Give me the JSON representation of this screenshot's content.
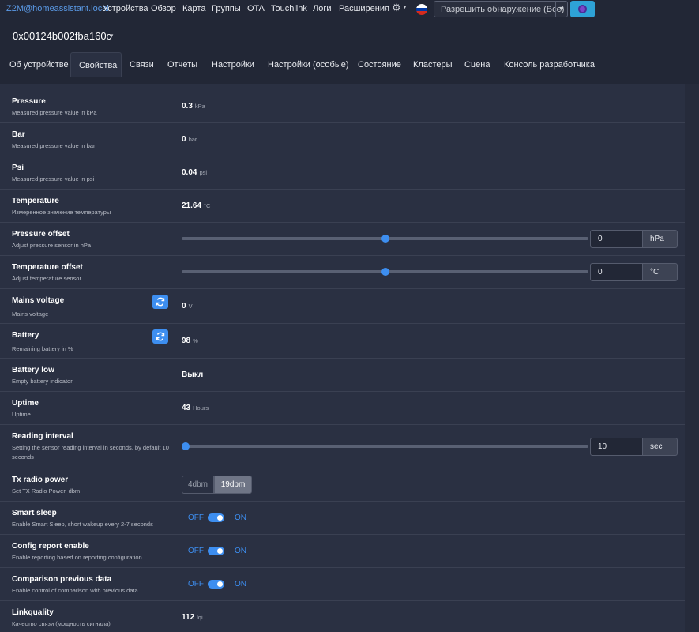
{
  "navbar": {
    "brand": "Z2M@homeassistant.local",
    "links": [
      "Устройства",
      "Обзор",
      "Карта",
      "Группы",
      "OTA",
      "Touchlink",
      "Логи",
      "Расширения"
    ],
    "permit_label": "Разрешить обнаружение (Все)",
    "flag_colors": [
      "#ffffff",
      "#0039a6",
      "#d52b1e"
    ]
  },
  "device": {
    "title": "0x00124b002fba160c"
  },
  "tabs": [
    "Об устройстве",
    "Свойства",
    "Связи",
    "Отчеты",
    "Настройки",
    "Настройки (особые)",
    "Состояние",
    "Кластеры",
    "Сцена",
    "Консоль разработчика"
  ],
  "active_tab": "Свойства",
  "props": {
    "pressure": {
      "title": "Pressure",
      "desc": "Measured pressure value in kPa",
      "value": "0.3",
      "unit": "kPa"
    },
    "bar": {
      "title": "Bar",
      "desc": "Measured pressure value in bar",
      "value": "0",
      "unit": "bar"
    },
    "psi": {
      "title": "Psi",
      "desc": "Measured pressure value in psi",
      "value": "0.04",
      "unit": "psi"
    },
    "temperature": {
      "title": "Temperature",
      "desc": "Измеренное значение температуры",
      "value": "21.64",
      "unit": "°C"
    },
    "pressure_offset": {
      "title": "Pressure offset",
      "desc": "Adjust pressure sensor in hPa",
      "value": "0",
      "unit": "hPa",
      "slider_fraction": 0.5
    },
    "temperature_offset": {
      "title": "Temperature offset",
      "desc": "Adjust temperature sensor",
      "value": "0",
      "unit": "°C",
      "slider_fraction": 0.5
    },
    "mains_voltage": {
      "title": "Mains voltage",
      "desc": "Mains voltage",
      "value": "0",
      "unit": "V"
    },
    "battery": {
      "title": "Battery",
      "desc": "Remaining battery in %",
      "value": "98",
      "unit": "%"
    },
    "battery_low": {
      "title": "Battery low",
      "desc": "Empty battery indicator",
      "value": "Выкл"
    },
    "uptime": {
      "title": "Uptime",
      "desc": "Uptime",
      "value": "43",
      "unit": "Hours"
    },
    "reading_interval": {
      "title": "Reading interval",
      "desc": "Setting the sensor reading interval in seconds, by default 10 seconds",
      "value": "10",
      "unit": "sec",
      "slider_fraction": 0.0
    },
    "tx_radio_power": {
      "title": "Tx radio power",
      "desc": "Set TX Radio Power, dbm",
      "options": [
        "4dbm",
        "19dbm"
      ],
      "selected": "19dbm"
    },
    "smart_sleep": {
      "title": "Smart sleep",
      "desc": "Enable Smart Sleep, short wakeup every 2-7 seconds",
      "off": "OFF",
      "on": "ON",
      "state": true
    },
    "config_report": {
      "title": "Config report enable",
      "desc": "Enable reporting based on reporting configuration",
      "off": "OFF",
      "on": "ON",
      "state": true
    },
    "comparison": {
      "title": "Comparison previous data",
      "desc": "Enable control of comparison with previous data",
      "off": "OFF",
      "on": "ON",
      "state": true
    },
    "linkquality": {
      "title": "Linkquality",
      "desc": "Качество связи (мощность сигнала)",
      "value": "112",
      "unit": "lqi"
    }
  },
  "colors": {
    "accent": "#3d8ef0",
    "background": "#222736",
    "card": "#2a3042"
  }
}
